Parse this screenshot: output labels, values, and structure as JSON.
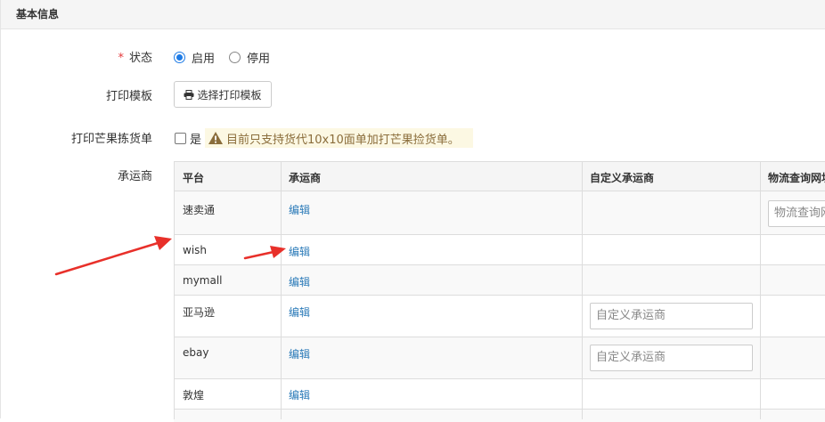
{
  "panel": {
    "title": "基本信息"
  },
  "form": {
    "status": {
      "required_mark": "*",
      "label": "状态",
      "options": [
        {
          "label": "启用",
          "checked": true
        },
        {
          "label": "停用",
          "checked": false
        }
      ]
    },
    "print_template": {
      "label": "打印模板",
      "button_label": "选择打印模板"
    },
    "print_mango": {
      "label": "打印芒果拣货单",
      "checkbox_label": "是",
      "checked": false,
      "warning": "目前只支持货代10x10面单加打芒果捡货单。"
    },
    "carrier": {
      "label": "承运商"
    }
  },
  "table": {
    "columns": [
      "平台",
      "承运商",
      "自定义承运商",
      "物流查询网址"
    ],
    "rows": [
      {
        "platform": "速卖通",
        "carrier": "编辑",
        "custom_placeholder": "",
        "url_placeholder": "物流查询网址"
      },
      {
        "platform": "wish",
        "carrier": "编辑",
        "custom_placeholder": "",
        "url_placeholder": ""
      },
      {
        "platform": "mymall",
        "carrier": "编辑",
        "custom_placeholder": "",
        "url_placeholder": ""
      },
      {
        "platform": "亚马逊",
        "carrier": "编辑",
        "custom_placeholder": "自定义承运商",
        "url_placeholder": ""
      },
      {
        "platform": "ebay",
        "carrier": "编辑",
        "custom_placeholder": "自定义承运商",
        "url_placeholder": ""
      },
      {
        "platform": "敦煌",
        "carrier": "编辑",
        "custom_placeholder": "",
        "url_placeholder": ""
      }
    ]
  },
  "colors": {
    "link": "#2a7ab8",
    "accent": "#1e7be6",
    "warning_bg": "#fcf8e3",
    "warning_text": "#8a6d3b",
    "annotation_arrow": "#e8302a"
  }
}
